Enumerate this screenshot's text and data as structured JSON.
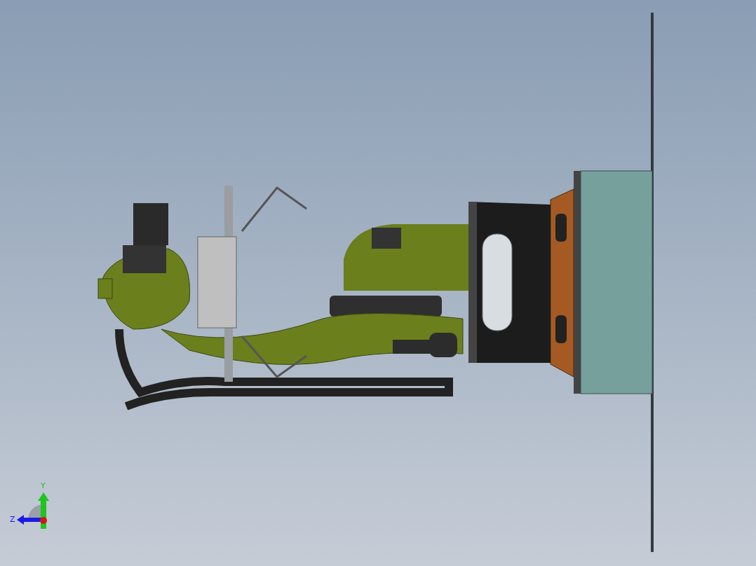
{
  "viewport": {
    "triad": {
      "axes": [
        {
          "label": "Y",
          "color": "#1fc41f"
        },
        {
          "label": "Z",
          "color": "#1a1ae6"
        }
      ]
    }
  }
}
